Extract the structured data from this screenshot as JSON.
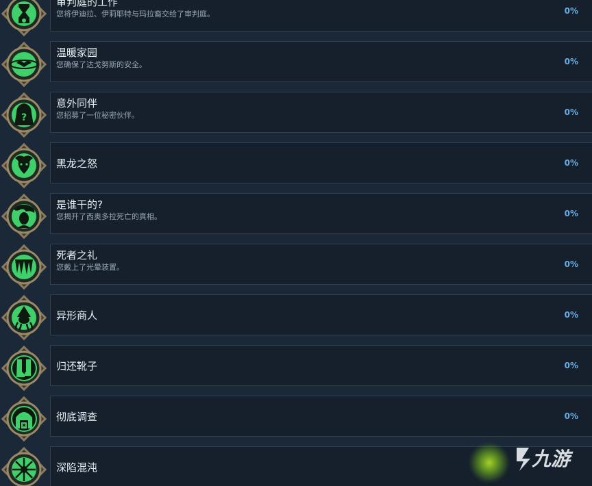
{
  "achievements": [
    {
      "title": "审判庭的工作",
      "description": "您将伊迪拉、伊莉耶特与玛拉裔交给了审判庭。",
      "percent": "0%",
      "icon": "hourglass-skull-icon"
    },
    {
      "title": "温暖家园",
      "description": "您确保了达戈努斯的安全。",
      "percent": "0%",
      "icon": "bat-planet-icon"
    },
    {
      "title": "意外同伴",
      "description": "您招募了一位秘密伙伴。",
      "percent": "0%",
      "icon": "hooded-question-icon"
    },
    {
      "title": "黑龙之怒",
      "description": "",
      "percent": "0%",
      "icon": "dragon-face-icon"
    },
    {
      "title": "是谁干的?",
      "description": "您揭开了西奥多拉死亡的真相。",
      "percent": "0%",
      "icon": "woman-portrait-icon"
    },
    {
      "title": "死者之礼",
      "description": "您戴上了光晕装置。",
      "percent": "0%",
      "icon": "fangs-icon"
    },
    {
      "title": "异形商人",
      "description": "",
      "percent": "0%",
      "icon": "tentacle-merchant-icon"
    },
    {
      "title": "归还靴子",
      "description": "",
      "percent": "0%",
      "icon": "boots-icon"
    },
    {
      "title": "彻底调查",
      "description": "",
      "percent": "0%",
      "icon": "archway-icon"
    },
    {
      "title": "深陷混沌",
      "description": "",
      "percent": "",
      "icon": "chaos-star-icon"
    }
  ],
  "watermark": {
    "text": "九游",
    "icon": "jiuyou-logo-icon"
  },
  "colors": {
    "background": "#1b2838",
    "card": "#16202c",
    "card_border": "#2f4152",
    "percent": "#66aee8",
    "icon_green": "#3fd06b",
    "icon_frame": "#8a7a5e"
  }
}
